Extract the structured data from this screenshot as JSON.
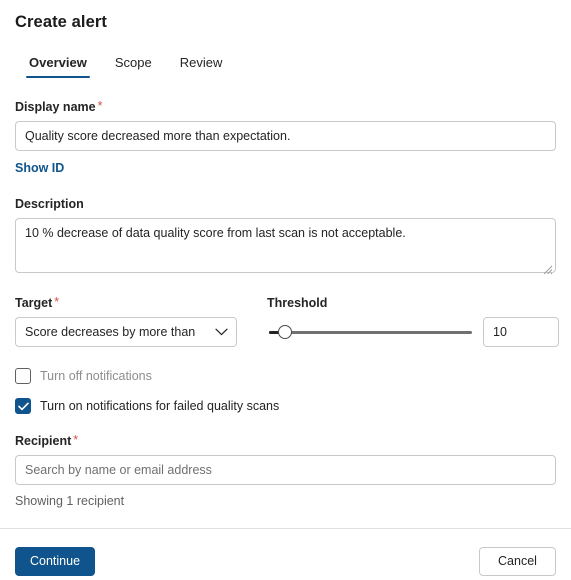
{
  "dialog": {
    "title": "Create alert"
  },
  "tabs": [
    {
      "label": "Overview",
      "active": true
    },
    {
      "label": "Scope",
      "active": false
    },
    {
      "label": "Review",
      "active": false
    }
  ],
  "fields": {
    "display_name": {
      "label": "Display name",
      "required_marker": "*",
      "value": "Quality score decreased more than expectation.",
      "placeholder": "",
      "show_id_link": "Show ID"
    },
    "description": {
      "label": "Description",
      "value": "10 % decrease of data quality score from last scan is not acceptable.",
      "placeholder": ""
    },
    "target": {
      "label": "Target",
      "required_marker": "*",
      "selected": "Score decreases by more than",
      "options": [
        "Score decreases by more than"
      ]
    },
    "threshold": {
      "label": "Threshold",
      "value": "10",
      "slider_percent": 5
    },
    "turn_off_notifications": {
      "label": "Turn off notifications",
      "checked": false
    },
    "turn_on_failed_scans": {
      "label": "Turn on notifications for failed quality scans",
      "checked": true
    },
    "recipient": {
      "label": "Recipient",
      "required_marker": "*",
      "value": "",
      "placeholder": "Search by name or email address",
      "status": "Showing 1 recipient"
    }
  },
  "footer": {
    "continue_label": "Continue",
    "cancel_label": "Cancel"
  },
  "colors": {
    "accent": "#0f548c",
    "link": "#0f548c",
    "required": "#d2544a",
    "border": "#c9c9c9",
    "text": "#242424",
    "muted": "#8d8d8d"
  }
}
